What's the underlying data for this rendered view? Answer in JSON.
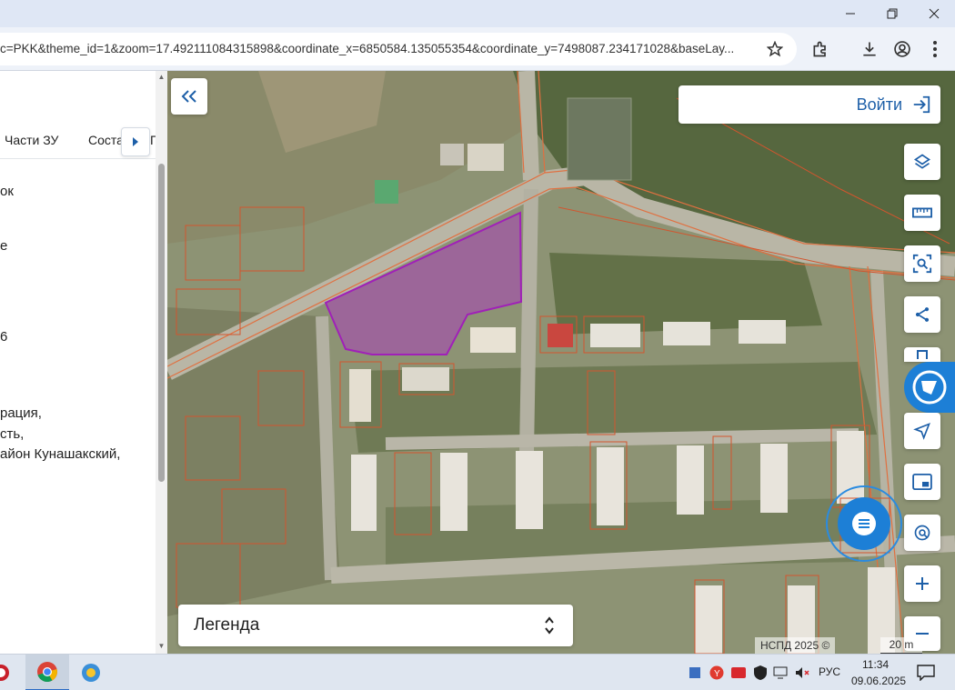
{
  "browser": {
    "url": "c=PKK&theme_id=1&zoom=17.492111084315898&coordinate_x=6850584.135055354&coordinate_y=7498087.234171028&baseLay..."
  },
  "sidebar": {
    "tabs": [
      {
        "label": "Части ЗУ"
      },
      {
        "label": "Соста"
      },
      {
        "label": "Г"
      }
    ],
    "lines": [
      "ок",
      "е",
      "6",
      "рация,",
      "сть,",
      "айон Кунашакский,"
    ]
  },
  "map": {
    "login_label": "Войти",
    "legend_label": "Легенда",
    "copyright": "НСПД 2025 ©",
    "scale_label": "20 m",
    "tools": [
      "layers-icon",
      "ruler-icon",
      "area-search-icon",
      "share-icon",
      "bookmark-icon",
      "navigate-icon",
      "picture-in-picture-icon",
      "location-search-icon",
      "zoom-in-icon",
      "zoom-out-icon"
    ]
  },
  "taskbar": {
    "language": "РУС",
    "time": "11:34",
    "date": "09.06.2025"
  },
  "colors": {
    "accent": "#1d5fa8",
    "parcel_highlight": "#b030c8",
    "road_line": "#e07040"
  }
}
